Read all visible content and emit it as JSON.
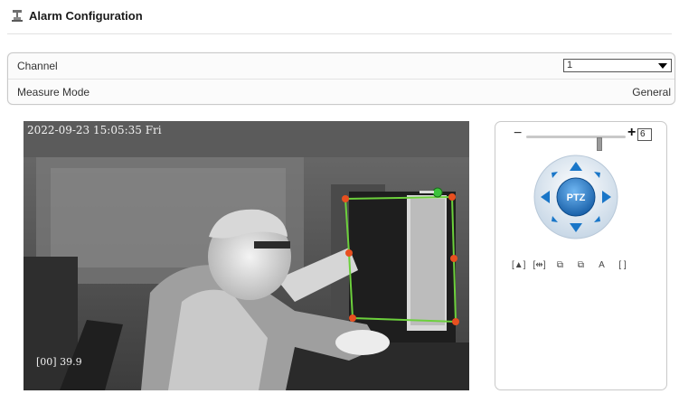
{
  "header": {
    "title": "Alarm Configuration",
    "icon": "tools-icon"
  },
  "settings": {
    "channel_label": "Channel",
    "channel_value": "1",
    "measure_mode_label": "Measure Mode",
    "measure_mode_value": "General"
  },
  "video": {
    "timestamp": "2022-09-23 15:05:35 Fri",
    "temperature_readout": "[00] 39.9",
    "roi_color": "#6cd03c",
    "roi_handle_color": "#e85020"
  },
  "ptz": {
    "zoom_value": "6",
    "zoom_level": 0.75,
    "zoom_minus": "−",
    "zoom_plus": "+",
    "center_label": "PTZ",
    "accent": "#1976c8",
    "tools": [
      "[▲]",
      "[⇹]",
      "⧉",
      "⧉",
      "A",
      "[ ]"
    ]
  }
}
